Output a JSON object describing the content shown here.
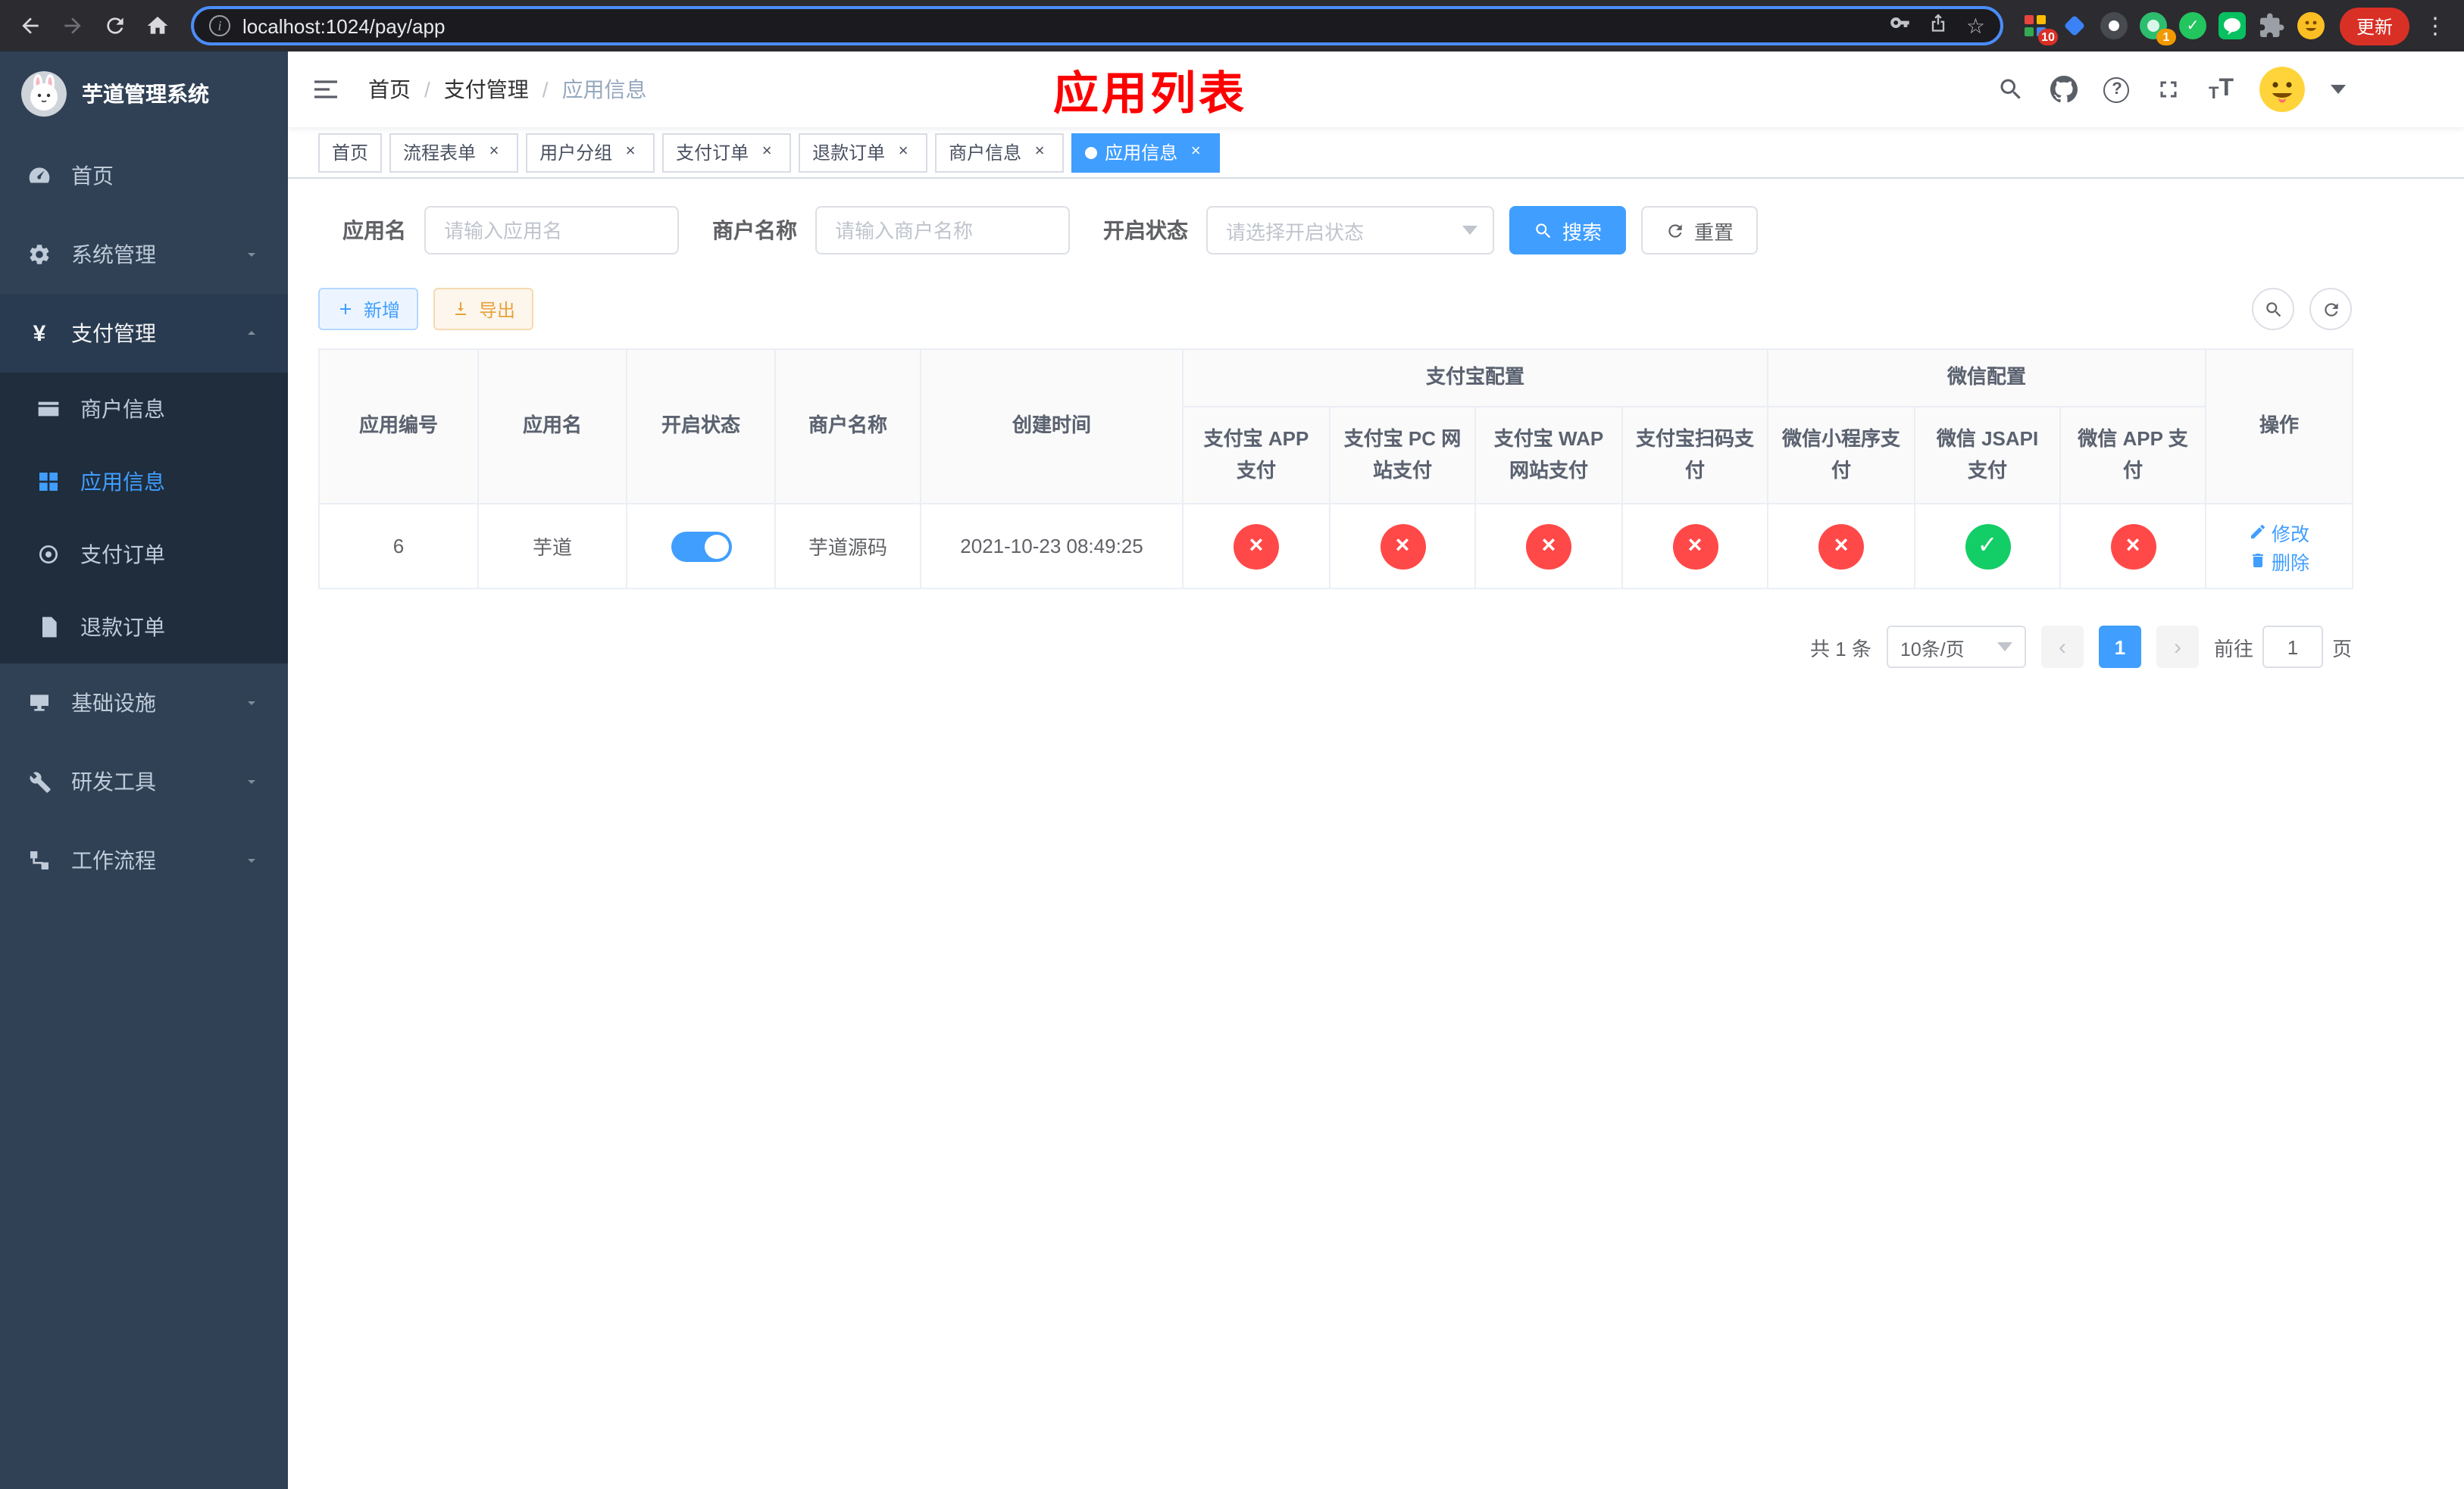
{
  "browser": {
    "url": "localhost:1024/pay/app",
    "update_button": "更新",
    "badges": {
      "extensions": "10",
      "notice": "1"
    }
  },
  "sidebar": {
    "app_title": "芋道管理系统",
    "items": [
      {
        "label": "首页"
      },
      {
        "label": "系统管理"
      },
      {
        "label": "支付管理"
      },
      {
        "label": "商户信息"
      },
      {
        "label": "应用信息"
      },
      {
        "label": "支付订单"
      },
      {
        "label": "退款订单"
      },
      {
        "label": "基础设施"
      },
      {
        "label": "研发工具"
      },
      {
        "label": "工作流程"
      }
    ]
  },
  "navbar": {
    "breadcrumb": [
      "首页",
      "支付管理",
      "应用信息"
    ],
    "page_overlay_title": "应用列表"
  },
  "tabs": [
    {
      "label": "首页"
    },
    {
      "label": "流程表单"
    },
    {
      "label": "用户分组"
    },
    {
      "label": "支付订单"
    },
    {
      "label": "退款订单"
    },
    {
      "label": "商户信息"
    },
    {
      "label": "应用信息"
    }
  ],
  "filters": {
    "app_name_label": "应用名",
    "app_name_placeholder": "请输入应用名",
    "merchant_label": "商户名称",
    "merchant_placeholder": "请输入商户名称",
    "status_label": "开启状态",
    "status_placeholder": "请选择开启状态",
    "search_button": "搜索",
    "reset_button": "重置"
  },
  "toolbar": {
    "add_button": "新增",
    "export_button": "导出"
  },
  "table": {
    "groups": {
      "alipay": "支付宝配置",
      "wechat": "微信配置"
    },
    "columns": {
      "id": "应用编号",
      "name": "应用名",
      "status": "开启状态",
      "merchant": "商户名称",
      "created": "创建时间",
      "alipay_app": "支付宝 APP 支付",
      "alipay_pc": "支付宝 PC 网站支付",
      "alipay_wap": "支付宝 WAP 网站支付",
      "alipay_qr": "支付宝扫码支付",
      "wx_lite": "微信小程序支付",
      "wx_jsapi": "微信 JSAPI 支付",
      "wx_app": "微信 APP 支付",
      "actions": "操作"
    },
    "row": {
      "id": "6",
      "name": "芋道",
      "enabled": true,
      "merchant": "芋道源码",
      "created": "2021-10-23 08:49:25",
      "channels": [
        "no",
        "no",
        "no",
        "no",
        "no",
        "yes",
        "no"
      ],
      "edit": "修改",
      "delete": "删除"
    }
  },
  "pagination": {
    "total": "共 1 条",
    "page_size": "10条/页",
    "current_page": "1",
    "goto_label": "前往",
    "goto_value": "1",
    "goto_suffix": "页"
  }
}
